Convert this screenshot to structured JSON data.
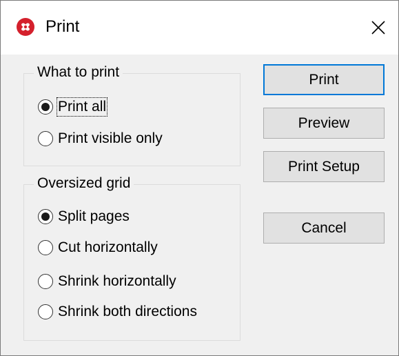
{
  "window": {
    "title": "Print",
    "icon": "app-logo-icon",
    "close_icon": "close-icon"
  },
  "what_to_print": {
    "legend": "What to print",
    "options": [
      {
        "label": "Print all",
        "selected": true
      },
      {
        "label": "Print visible only",
        "selected": false
      }
    ]
  },
  "oversized_grid": {
    "legend": "Oversized grid",
    "options": [
      {
        "label": "Split pages",
        "selected": true
      },
      {
        "label": "Cut horizontally",
        "selected": false
      },
      {
        "label": "Shrink horizontally",
        "selected": false
      },
      {
        "label": "Shrink both directions",
        "selected": false
      }
    ]
  },
  "buttons": {
    "print": "Print",
    "preview": "Preview",
    "print_setup": "Print Setup",
    "cancel": "Cancel"
  },
  "colors": {
    "accent": "#0078d7",
    "icon_red": "#d4202c",
    "dialog_bg": "#f0f0f0",
    "button_bg": "#e1e1e1"
  }
}
